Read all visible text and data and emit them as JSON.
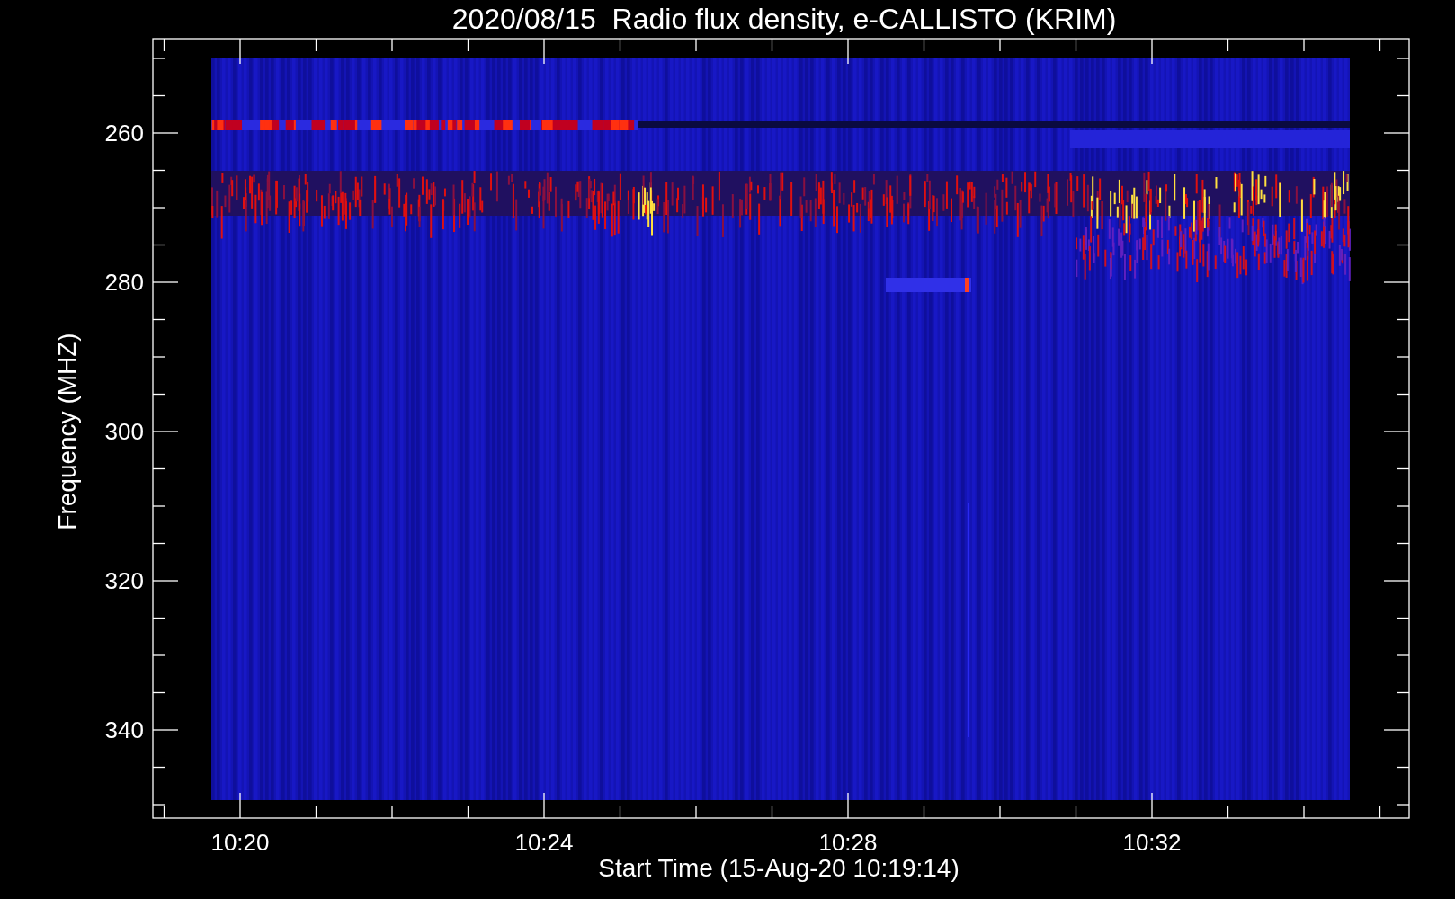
{
  "title": "2020/08/15  Radio flux density, e-CALLISTO (KRIM)",
  "y_axis": {
    "label": "Frequency (MHZ)",
    "ticks": [
      "260",
      "280",
      "300",
      "320",
      "340"
    ]
  },
  "x_axis": {
    "label": "Start Time (15-Aug-20 10:19:14)",
    "ticks": [
      "10:20",
      "10:24",
      "10:28",
      "10:32"
    ]
  }
}
